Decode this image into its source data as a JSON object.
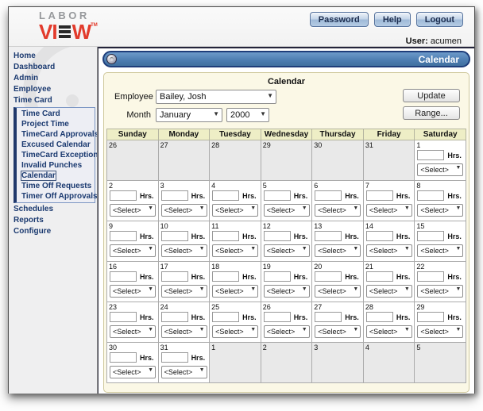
{
  "banner": {
    "logo": {
      "labor": "LABOR",
      "view_v": "V",
      "view_i": "I",
      "view_w": "W",
      "tm": "TM"
    },
    "buttons": [
      {
        "label": "Password",
        "name": "password-button"
      },
      {
        "label": "Help",
        "name": "help-button"
      },
      {
        "label": "Logout",
        "name": "logout-button"
      }
    ],
    "user_label": "User:",
    "user_name": "acumen"
  },
  "sidebar": {
    "top_items": [
      "Home",
      "Dashboard",
      "Admin",
      "Employee",
      "Time Card"
    ],
    "submenu": {
      "items": [
        "Time Card",
        "Project Time",
        "TimeCard Approvals",
        "Excused Calendar",
        "TimeCard Exceptions",
        "Invalid Punches",
        "Calendar",
        "Time Off Requests",
        "Timer Off Approvals"
      ],
      "selected": "Calendar"
    },
    "bottom_items": [
      "Schedules",
      "Reports",
      "Configure"
    ]
  },
  "header_bar": {
    "title": "Calendar"
  },
  "panel": {
    "title": "Calendar",
    "employee_label": "Employee",
    "employee_value": "Bailey, Josh",
    "month_label": "Month",
    "month_value": "January",
    "year_value": "2000",
    "update_label": "Update",
    "range_label": "Range...",
    "hrs_label": "Hrs.",
    "select_placeholder": "<Select>"
  },
  "calendar": {
    "day_headers": [
      "Sunday",
      "Monday",
      "Tuesday",
      "Wednesday",
      "Thursday",
      "Friday",
      "Saturday"
    ],
    "weeks": [
      [
        {
          "date": "26",
          "current": false,
          "editable": false
        },
        {
          "date": "27",
          "current": false,
          "editable": false
        },
        {
          "date": "28",
          "current": false,
          "editable": false
        },
        {
          "date": "29",
          "current": false,
          "editable": false
        },
        {
          "date": "30",
          "current": false,
          "editable": false
        },
        {
          "date": "31",
          "current": false,
          "editable": false
        },
        {
          "date": "1",
          "current": true,
          "editable": true
        }
      ],
      [
        {
          "date": "2",
          "current": true,
          "editable": true
        },
        {
          "date": "3",
          "current": true,
          "editable": true
        },
        {
          "date": "4",
          "current": true,
          "editable": true
        },
        {
          "date": "5",
          "current": true,
          "editable": true
        },
        {
          "date": "6",
          "current": true,
          "editable": true
        },
        {
          "date": "7",
          "current": true,
          "editable": true
        },
        {
          "date": "8",
          "current": true,
          "editable": true
        }
      ],
      [
        {
          "date": "9",
          "current": true,
          "editable": true
        },
        {
          "date": "10",
          "current": true,
          "editable": true
        },
        {
          "date": "11",
          "current": true,
          "editable": true
        },
        {
          "date": "12",
          "current": true,
          "editable": true
        },
        {
          "date": "13",
          "current": true,
          "editable": true
        },
        {
          "date": "14",
          "current": true,
          "editable": true
        },
        {
          "date": "15",
          "current": true,
          "editable": true
        }
      ],
      [
        {
          "date": "16",
          "current": true,
          "editable": true
        },
        {
          "date": "17",
          "current": true,
          "editable": true
        },
        {
          "date": "18",
          "current": true,
          "editable": true
        },
        {
          "date": "19",
          "current": true,
          "editable": true
        },
        {
          "date": "20",
          "current": true,
          "editable": true
        },
        {
          "date": "21",
          "current": true,
          "editable": true
        },
        {
          "date": "22",
          "current": true,
          "editable": true
        }
      ],
      [
        {
          "date": "23",
          "current": true,
          "editable": true
        },
        {
          "date": "24",
          "current": true,
          "editable": true
        },
        {
          "date": "25",
          "current": true,
          "editable": true
        },
        {
          "date": "26",
          "current": true,
          "editable": true
        },
        {
          "date": "27",
          "current": true,
          "editable": true
        },
        {
          "date": "28",
          "current": true,
          "editable": true
        },
        {
          "date": "29",
          "current": true,
          "editable": true
        }
      ],
      [
        {
          "date": "30",
          "current": true,
          "editable": true
        },
        {
          "date": "31",
          "current": true,
          "editable": true
        },
        {
          "date": "1",
          "current": false,
          "editable": false
        },
        {
          "date": "2",
          "current": false,
          "editable": false
        },
        {
          "date": "3",
          "current": false,
          "editable": false
        },
        {
          "date": "4",
          "current": false,
          "editable": false
        },
        {
          "date": "5",
          "current": false,
          "editable": false
        }
      ]
    ]
  },
  "colors": {
    "accent_blue": "#4c7cb0",
    "logo_red": "#e23b2c",
    "panel_cream": "#fbf8e6",
    "day_header_yellow": "#eeeec6",
    "other_month_gray": "#e9e9e9",
    "nav_navy": "#1b3a70"
  }
}
